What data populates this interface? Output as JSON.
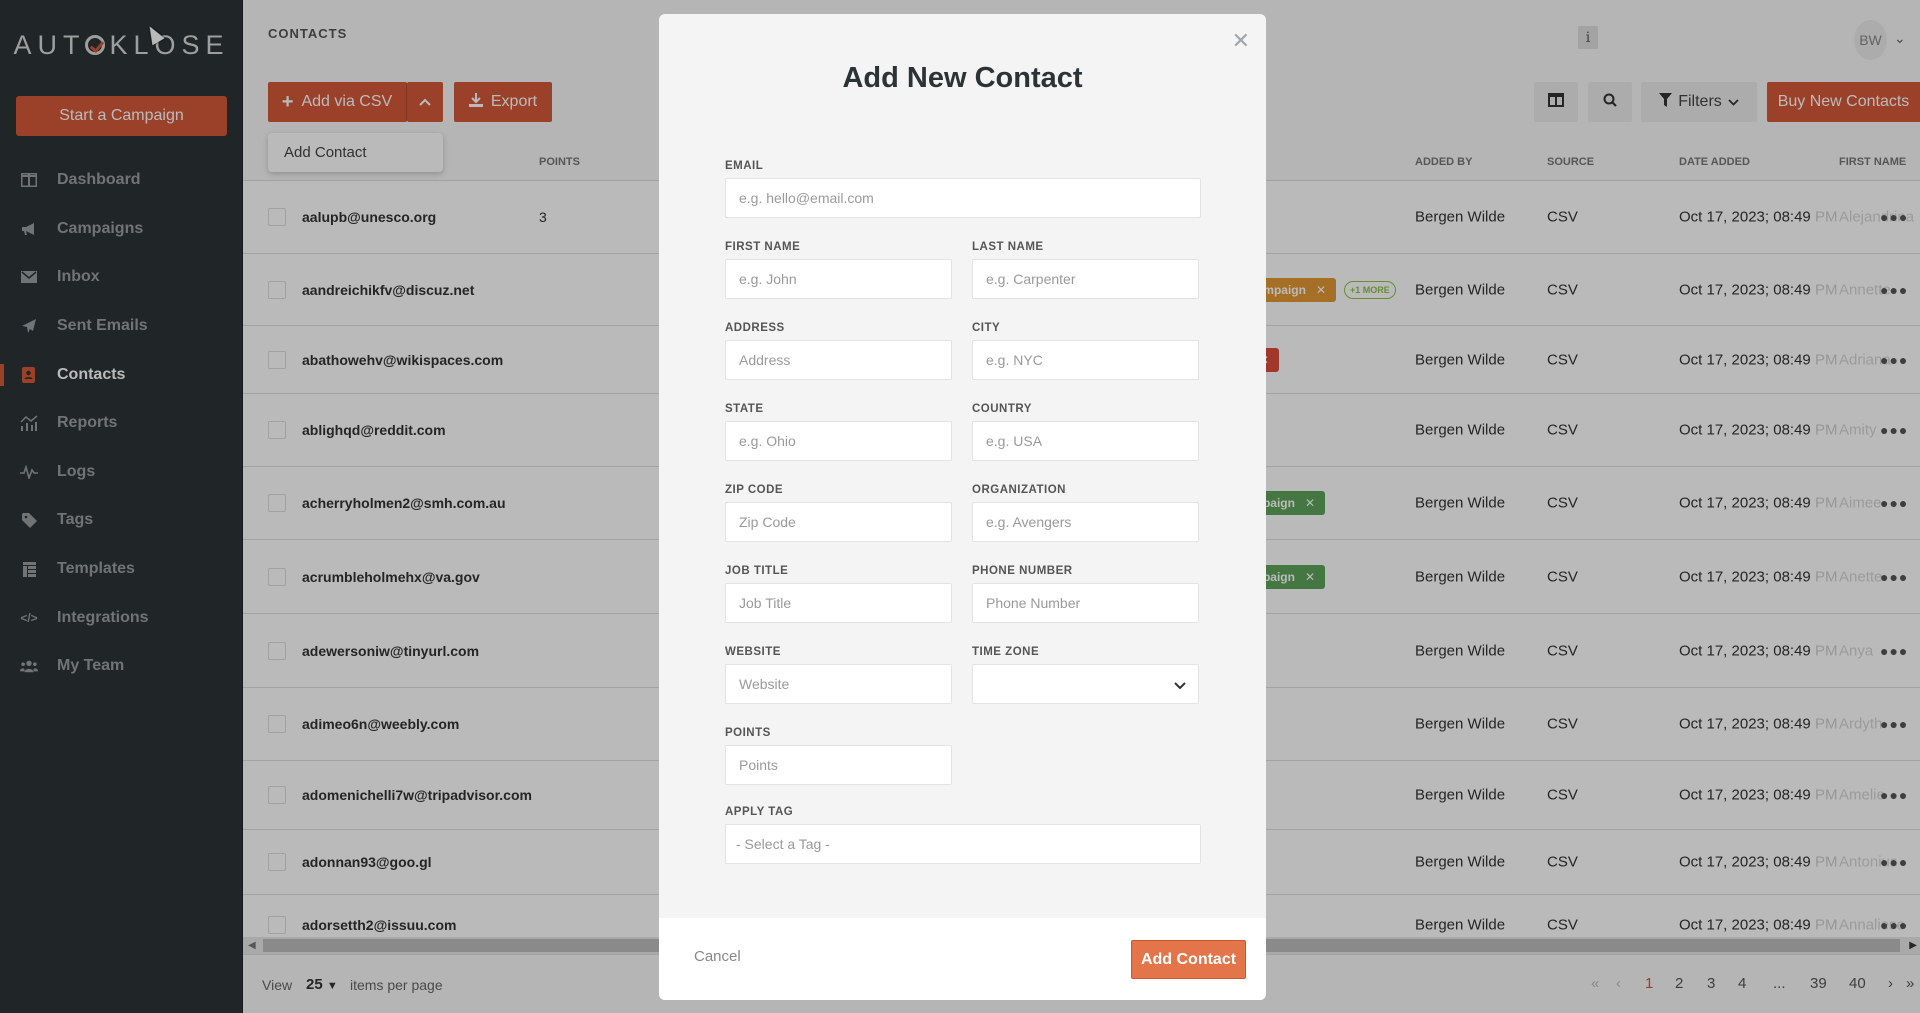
{
  "app": {
    "logo": "AUTOKLOSE",
    "start_campaign": "Start a Campaign"
  },
  "sidebar": {
    "items": [
      {
        "label": "Dashboard",
        "icon": "dashboard-icon"
      },
      {
        "label": "Campaigns",
        "icon": "megaphone-icon"
      },
      {
        "label": "Inbox",
        "icon": "envelope-icon"
      },
      {
        "label": "Sent Emails",
        "icon": "paper-plane-icon"
      },
      {
        "label": "Contacts",
        "icon": "address-book-icon",
        "active": true
      },
      {
        "label": "Reports",
        "icon": "chart-icon"
      },
      {
        "label": "Logs",
        "icon": "pulse-icon"
      },
      {
        "label": "Tags",
        "icon": "tag-icon"
      },
      {
        "label": "Templates",
        "icon": "template-icon"
      },
      {
        "label": "Integrations",
        "icon": "code-icon"
      },
      {
        "label": "My Team",
        "icon": "team-icon"
      }
    ]
  },
  "header": {
    "title": "CONTACTS",
    "add_via_csv": "Add via CSV",
    "export": "Export",
    "dropdown_item": "Add Contact",
    "info": "i",
    "avatar_initials": "BW",
    "filters": "Filters",
    "buy_contacts": "Buy New Contacts"
  },
  "table": {
    "columns": {
      "points": "POINTS",
      "added_by": "ADDED BY",
      "source": "SOURCE",
      "date_added": "DATE ADDED",
      "first_name": "FIRST NAME"
    },
    "rows": [
      {
        "email": "aalupb@unesco.org",
        "points": "3",
        "added_by": "Bergen Wilde",
        "source": "CSV",
        "date": "Oct 17, 2023; 08:49",
        "pm": "PM",
        "first_name": "Alejandrina"
      },
      {
        "email": "aandreichikfv@discuz.net",
        "points": "",
        "added_by": "Bergen Wilde",
        "source": "CSV",
        "date": "Oct 17, 2023; 08:49",
        "pm": "PM",
        "first_name": "Annette",
        "tag": {
          "label": "ampaign",
          "color": "#e29a33"
        },
        "more": "+1 MORE"
      },
      {
        "email": "abathowehv@wikispaces.com",
        "points": "",
        "added_by": "Bergen Wilde",
        "source": "CSV",
        "date": "Oct 17, 2023; 08:49",
        "pm": "PM",
        "first_name": "Adriana",
        "tag": {
          "label": "",
          "color": "#dc4f3c"
        }
      },
      {
        "email": "ablighqd@reddit.com",
        "points": "",
        "added_by": "Bergen Wilde",
        "source": "CSV",
        "date": "Oct 17, 2023; 08:49",
        "pm": "PM",
        "first_name": "Amity"
      },
      {
        "email": "acherryholmen2@smh.com.au",
        "points": "",
        "added_by": "Bergen Wilde",
        "source": "CSV",
        "date": "Oct 17, 2023; 08:49",
        "pm": "PM",
        "first_name": "Aimee",
        "tag": {
          "label": "paign",
          "color": "#5ea35a"
        }
      },
      {
        "email": "acrumbleholmehx@va.gov",
        "points": "",
        "added_by": "Bergen Wilde",
        "source": "CSV",
        "date": "Oct 17, 2023; 08:49",
        "pm": "PM",
        "first_name": "Anette",
        "tag": {
          "label": "paign",
          "color": "#5ea35a"
        }
      },
      {
        "email": "adewersoniw@tinyurl.com",
        "points": "",
        "added_by": "Bergen Wilde",
        "source": "CSV",
        "date": "Oct 17, 2023; 08:49",
        "pm": "PM",
        "first_name": "Anya"
      },
      {
        "email": "adimeo6n@weebly.com",
        "points": "",
        "added_by": "Bergen Wilde",
        "source": "CSV",
        "date": "Oct 17, 2023; 08:49",
        "pm": "PM",
        "first_name": "Ardyth"
      },
      {
        "email": "adomenichelli7w@tripadvisor.com",
        "points": "",
        "added_by": "Bergen Wilde",
        "source": "CSV",
        "date": "Oct 17, 2023; 08:49",
        "pm": "PM",
        "first_name": "Amelie"
      },
      {
        "email": "adonnan93@goo.gl",
        "points": "",
        "added_by": "Bergen Wilde",
        "source": "CSV",
        "date": "Oct 17, 2023; 08:49",
        "pm": "PM",
        "first_name": "Antonius"
      },
      {
        "email": "adorsetth2@issuu.com",
        "points": "",
        "added_by": "Bergen Wilde",
        "source": "CSV",
        "date": "Oct 17, 2023; 08:49",
        "pm": "PM",
        "first_name": "Annaliese"
      }
    ]
  },
  "footer": {
    "view": "View",
    "per_page": "25",
    "items_per_page": "items per page",
    "pages": [
      "1",
      "2",
      "3",
      "4",
      "...",
      "39",
      "40"
    ],
    "current_page": "1"
  },
  "modal": {
    "title": "Add New Contact",
    "fields": {
      "email": {
        "label": "EMAIL",
        "placeholder": "e.g. hello@email.com"
      },
      "first_name": {
        "label": "FIRST NAME",
        "placeholder": "e.g. John"
      },
      "last_name": {
        "label": "LAST NAME",
        "placeholder": "e.g. Carpenter"
      },
      "address": {
        "label": "ADDRESS",
        "placeholder": "Address"
      },
      "city": {
        "label": "CITY",
        "placeholder": "e.g. NYC"
      },
      "state": {
        "label": "STATE",
        "placeholder": "e.g. Ohio"
      },
      "country": {
        "label": "COUNTRY",
        "placeholder": "e.g. USA"
      },
      "zip": {
        "label": "ZIP CODE",
        "placeholder": "Zip Code"
      },
      "organization": {
        "label": "ORGANIZATION",
        "placeholder": "e.g. Avengers"
      },
      "job_title": {
        "label": "JOB TITLE",
        "placeholder": "Job Title"
      },
      "phone": {
        "label": "PHONE NUMBER",
        "placeholder": "Phone Number"
      },
      "website": {
        "label": "WEBSITE",
        "placeholder": "Website"
      },
      "time_zone": {
        "label": "TIME ZONE",
        "value": ""
      },
      "points": {
        "label": "POINTS",
        "placeholder": "Points"
      },
      "apply_tag": {
        "label": "APPLY TAG",
        "value": "- Select a Tag -"
      }
    },
    "cancel": "Cancel",
    "submit": "Add Contact"
  },
  "colors": {
    "accent": "#d5593a",
    "sidebar_bg": "#2c3336",
    "tag_orange": "#e29a33",
    "tag_red": "#dc4f3c",
    "tag_green": "#5ea35a",
    "more_badge": "#8bc34a"
  }
}
